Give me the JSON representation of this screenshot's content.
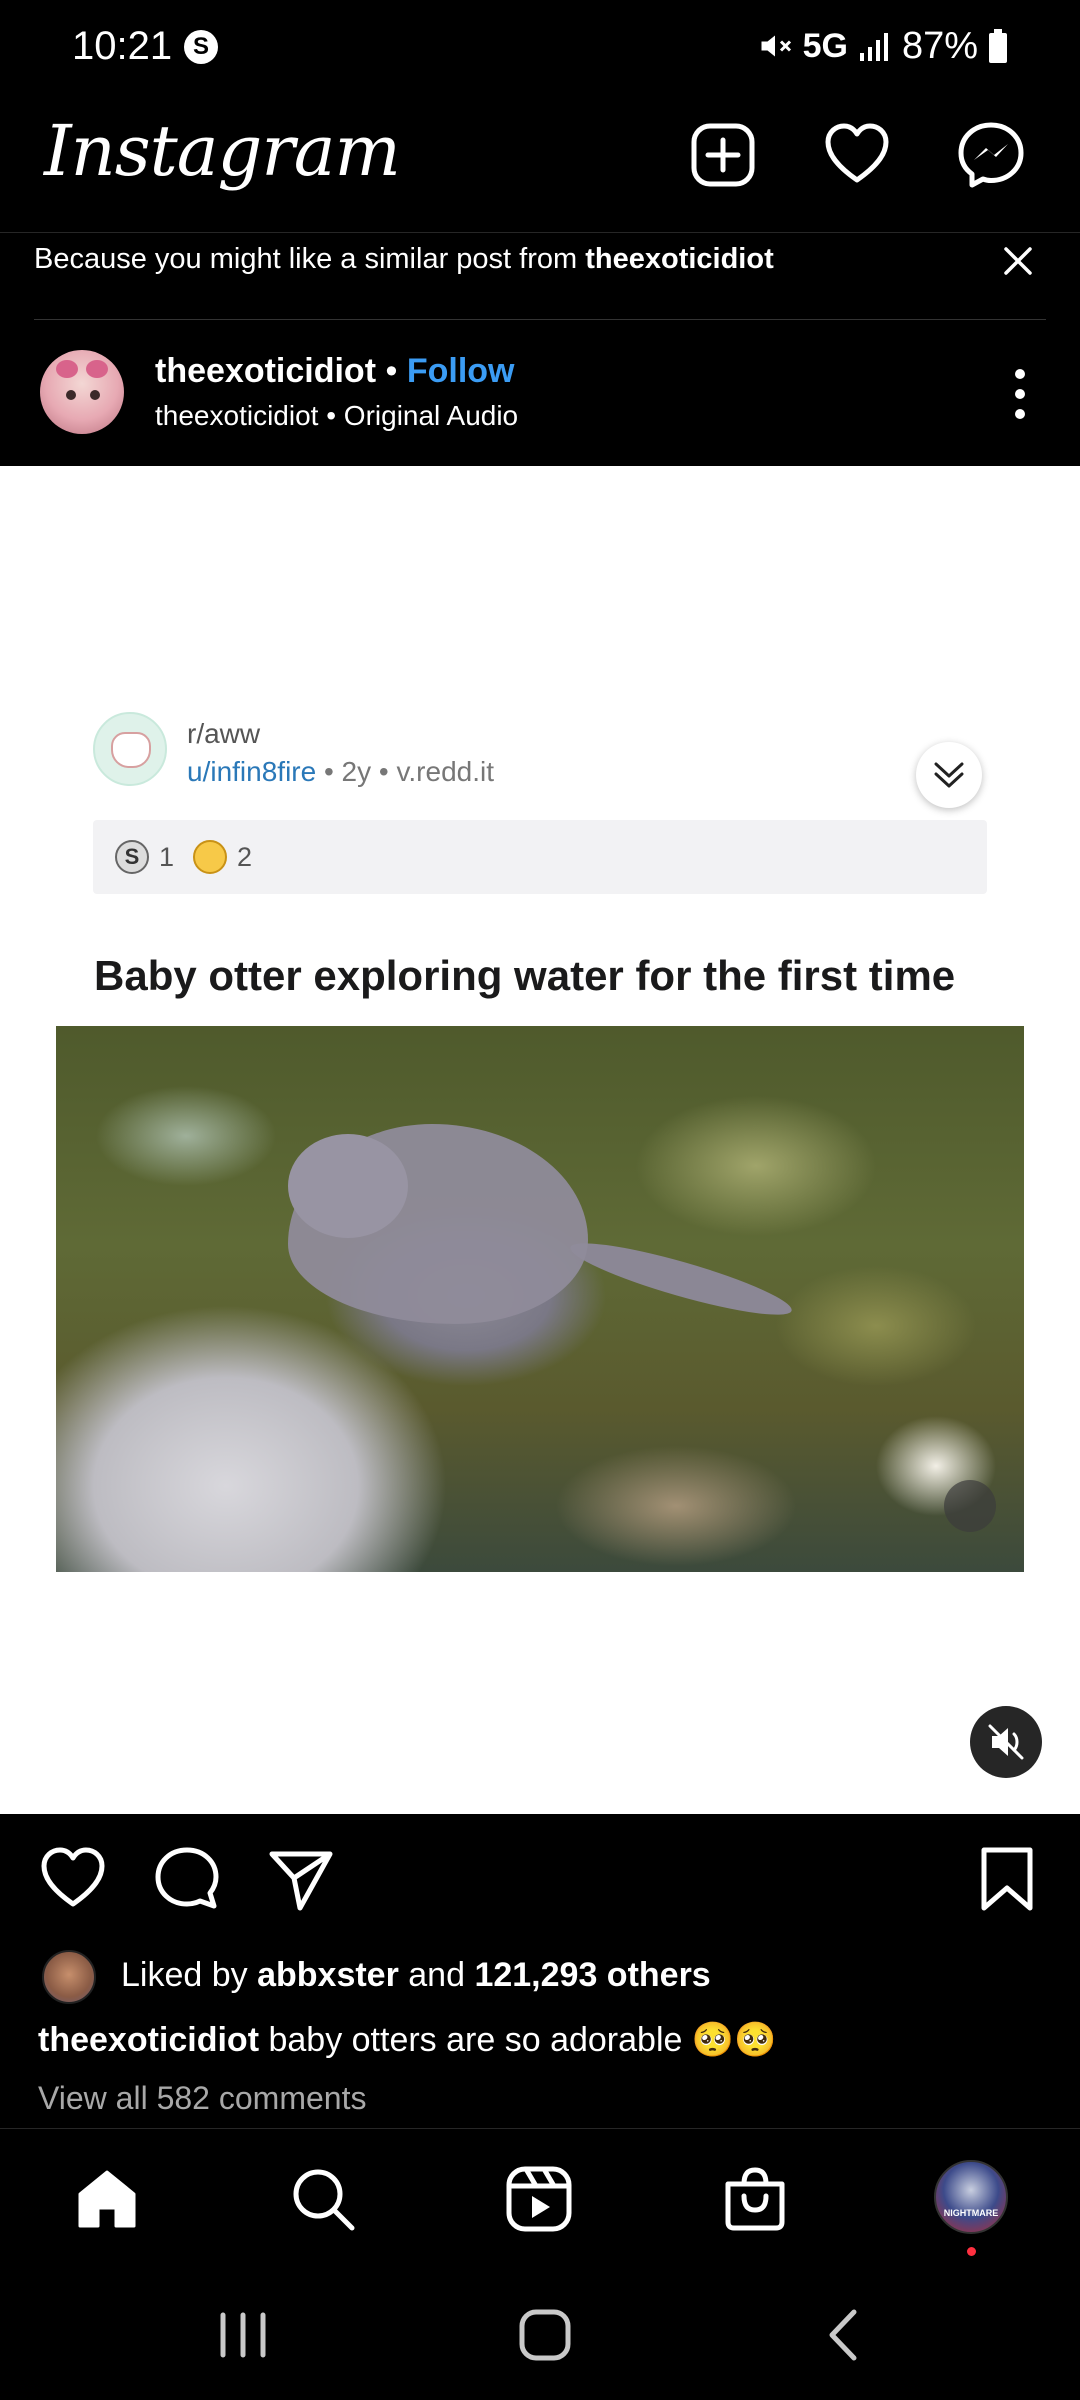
{
  "status_bar": {
    "time": "10:21",
    "network": "5G",
    "battery": "87%"
  },
  "header": {
    "logo": "Instagram"
  },
  "suggestion": {
    "prefix": "Because you might like a similar post from ",
    "account": "theexoticidiot"
  },
  "post": {
    "username": "theexoticidiot",
    "follow_label": "Follow",
    "separator": "•",
    "audio": "theexoticidiot • Original Audio"
  },
  "reddit": {
    "subreddit": "r/aww",
    "user": "u/infin8fire",
    "meta": " • 2y • v.redd.it",
    "award1_count": "1",
    "award2_count": "2",
    "title": "Baby otter exploring water for the first time"
  },
  "engagement": {
    "liked_by_prefix": "Liked by ",
    "liked_by_user": "abbxster",
    "liked_by_mid": " and ",
    "liked_by_others": "121,293 others",
    "caption_user": "theexoticidiot",
    "caption_text": " baby otters are so adorable 🥺🥺",
    "view_comments": "View all 582 comments"
  },
  "bottom_nav": {
    "items": [
      "home-icon",
      "search-icon",
      "reels-icon",
      "shop-icon",
      "profile-avatar"
    ],
    "profile_text": "NIGHTMARE"
  }
}
